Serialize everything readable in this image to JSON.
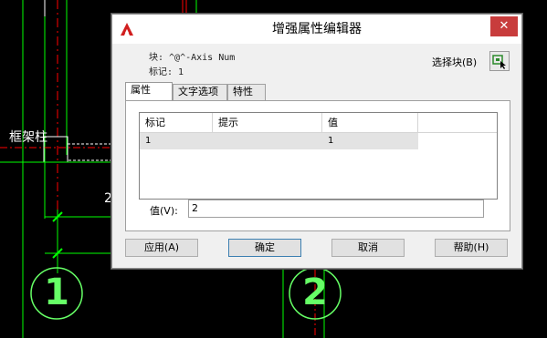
{
  "cad": {
    "label_frame_column": "框架柱",
    "bubble_1": "1",
    "bubble_2": "2",
    "dim_2": "2"
  },
  "dialog": {
    "title": "增强属性编辑器",
    "close_glyph": "✕",
    "block_line": "块: ^@^-Axis Num",
    "tag_line": "标记: 1",
    "select_block_label": "选择块(B)",
    "tabs": [
      "属性",
      "文字选项",
      "特性"
    ],
    "grid": {
      "headers": [
        "标记",
        "提示",
        "值"
      ],
      "rows": [
        {
          "tag": "1",
          "prompt": "",
          "value": "1"
        }
      ]
    },
    "value_label": "值(V):",
    "value_input": "2",
    "buttons": {
      "apply": "应用(A)",
      "ok": "确定",
      "cancel": "取消",
      "help": "帮助(H)"
    }
  },
  "colors": {
    "cad_background": "#000000",
    "grid_line_green": "#00ff00",
    "axis_line_red": "#ff0000",
    "bubble_green": "#66ff66"
  }
}
